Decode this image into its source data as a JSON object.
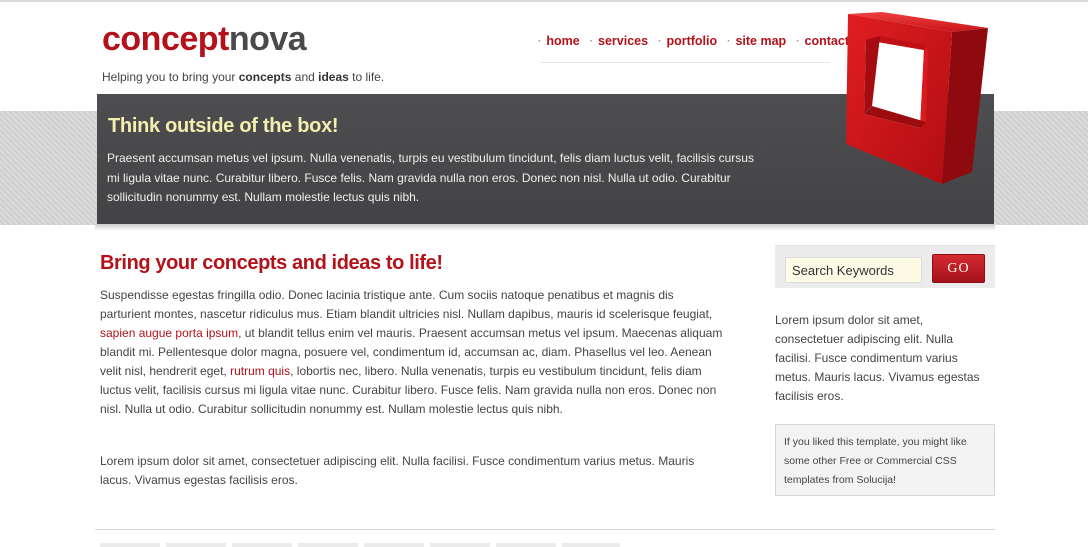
{
  "header": {
    "logo_part1": "concept",
    "logo_part2": "nova",
    "tagline_pre": "Helping you to bring your ",
    "tagline_b1": "concepts",
    "tagline_mid": " and ",
    "tagline_b2": "ideas",
    "tagline_post": " to life."
  },
  "nav": {
    "items": [
      "home",
      "services",
      "portfolio",
      "site map",
      "contact"
    ]
  },
  "hero": {
    "title": "Think outside of the box!",
    "text": "Praesent accumsan metus vel ipsum. Nulla venenatis, turpis eu vestibulum tincidunt, felis diam luctus velit, facilisis cursus mi ligula vitae nunc. Curabitur libero. Fusce felis. Nam gravida nulla non eros. Donec non nisl. Nulla ut odio. Curabitur sollicitudin nonummy est. Nullam molestie lectus quis nibh."
  },
  "main": {
    "title": "Bring your concepts and ideas to life!",
    "para1_a": "Suspendisse egestas fringilla odio. Donec lacinia tristique ante. Cum sociis natoque penatibus et magnis dis parturient montes, nascetur ridiculus mus. Etiam blandit ultricies nisl. Nullam dapibus, mauris id scelerisque feugiat, ",
    "para1_link1": "sapien augue porta ipsum",
    "para1_b": ", ut blandit tellus enim vel mauris. Praesent accumsan metus vel ipsum. Maecenas aliquam blandit mi. Pellentesque dolor magna, posuere vel, condimentum id, accumsan ac, diam. Phasellus vel leo. Aenean velit nisl, hendrerit eget, ",
    "para1_link2": "rutrum quis",
    "para1_c": ", lobortis nec, libero. Nulla venenatis, turpis eu vestibulum tincidunt, felis diam luctus velit, facilisis cursus mi ligula vitae nunc. Curabitur libero. Fusce felis. Nam gravida nulla non eros. Donec non nisl. Nulla ut odio. Curabitur sollicitudin nonummy est. Nullam molestie lectus quis nibh.",
    "para2": "Lorem ipsum dolor sit amet, consectetuer adipiscing elit. Nulla facilisi. Fusce condimentum varius metus. Mauris lacus. Vivamus egestas facilisis eros."
  },
  "sidebar": {
    "search_value": "Search Keywords",
    "go_label": "GO",
    "text": "Lorem ipsum dolor sit amet, consectetuer adipiscing elit. Nulla facilisi. Fusce condimentum varius metus. Mauris lacus. Vivamus egestas facilisis eros.",
    "note": "If you liked this template, you might like some other Free or Commercial CSS templates from Solucija!"
  },
  "colors": {
    "brand_red": "#b3121a",
    "hero_bg": "#4a4a4c",
    "hero_title": "#f2efb0"
  },
  "icons": {
    "hero_graphic": "red-box-icon"
  }
}
